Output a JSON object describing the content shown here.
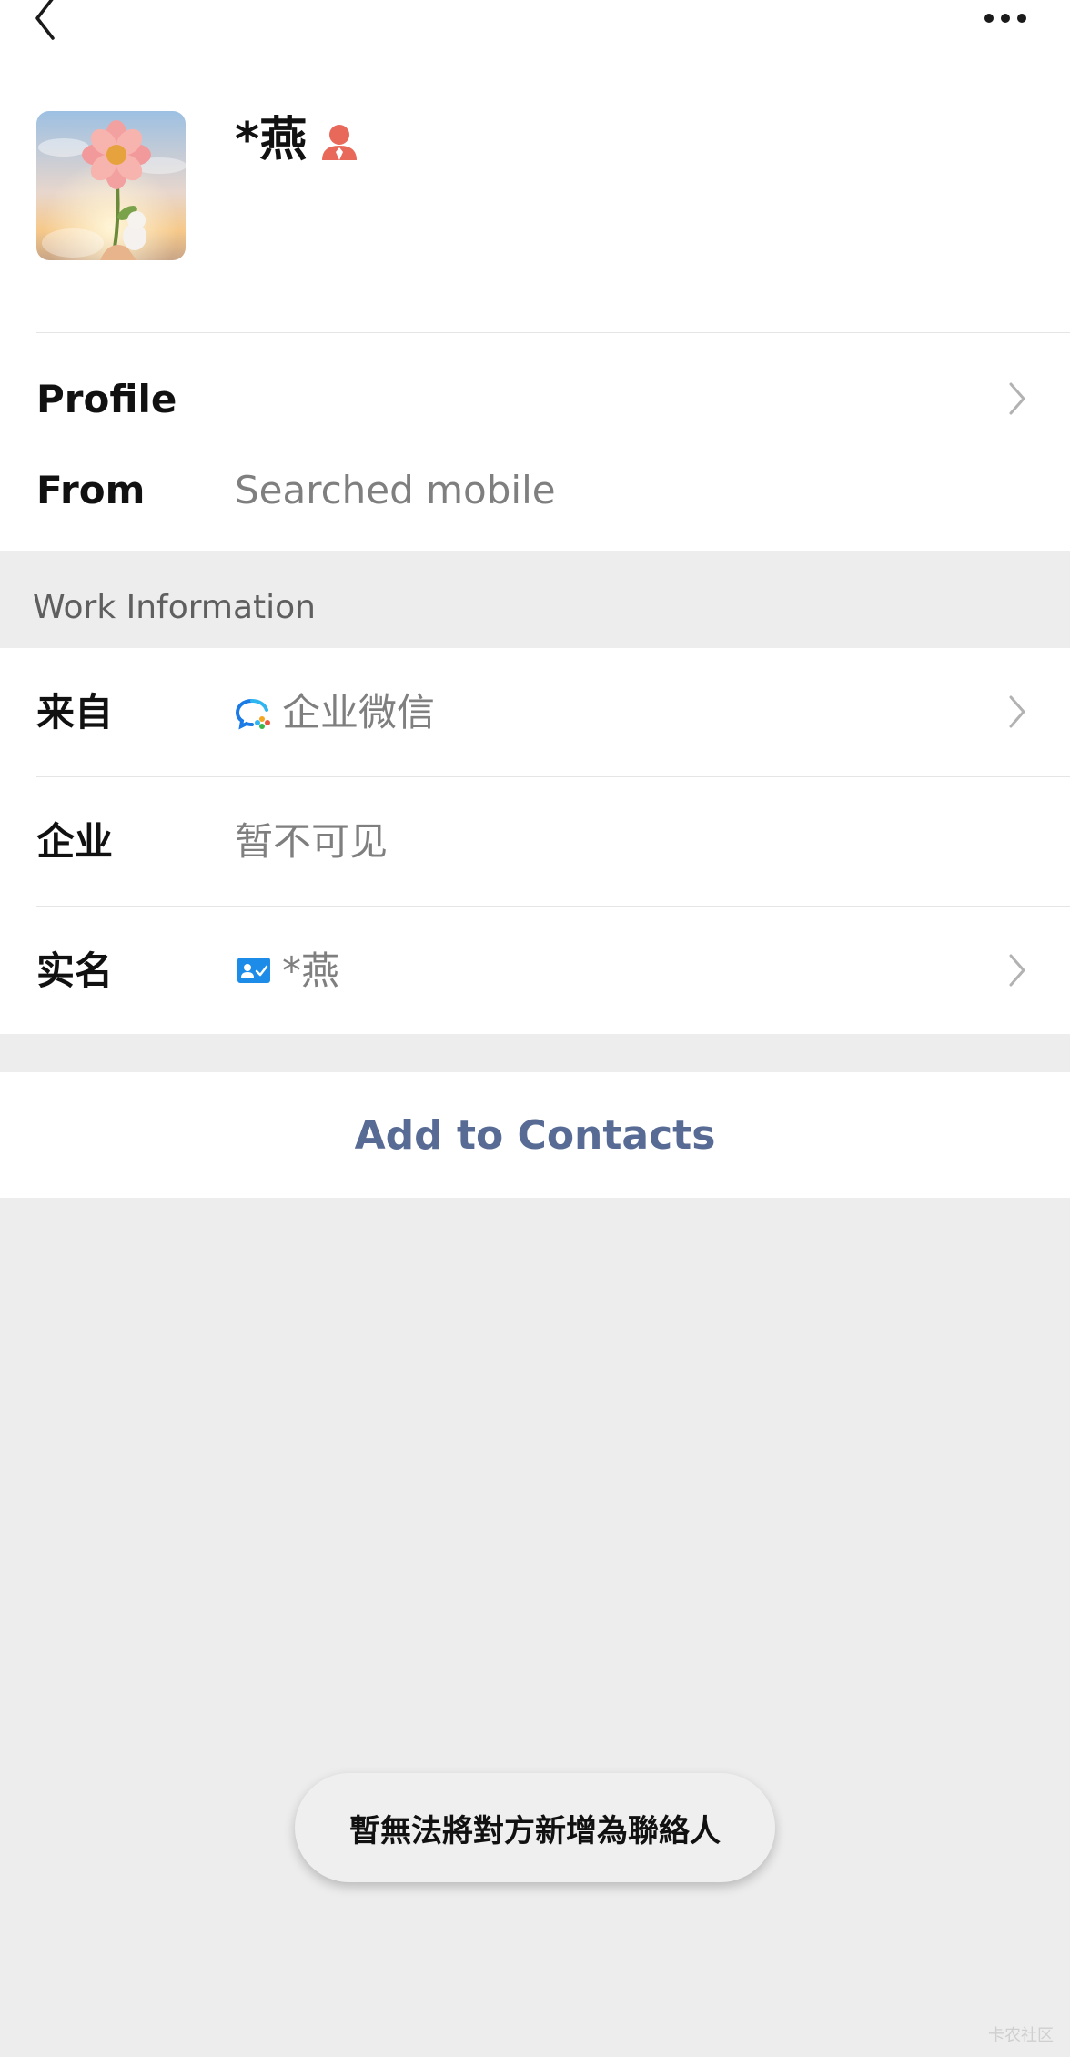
{
  "header": {
    "back_icon": "chevron-left-icon",
    "more_icon": "more-horizontal-icon"
  },
  "profile": {
    "name": "*燕",
    "name_badge_icon": "person-badge-icon",
    "avatar": "flower-avatar-image"
  },
  "rows": {
    "profile_label": "Profile",
    "from_label": "From",
    "from_value": "Searched mobile"
  },
  "work_info": {
    "section_title": "Work Information",
    "from_label": "来自",
    "from_value": "企业微信",
    "from_icon": "wecom-icon",
    "company_label": "企业",
    "company_value": "暂不可见",
    "realname_label": "实名",
    "realname_value": "*燕",
    "realname_icon": "id-card-verified-icon"
  },
  "actions": {
    "add_to_contacts": "Add to Contacts"
  },
  "toast": {
    "message": "暫無法將對方新增為聯絡人"
  },
  "watermark": "卡农社区",
  "colors": {
    "link": "#576b95",
    "background": "#ededed",
    "badge": "#e8685a",
    "id_icon": "#1d8ce8"
  }
}
